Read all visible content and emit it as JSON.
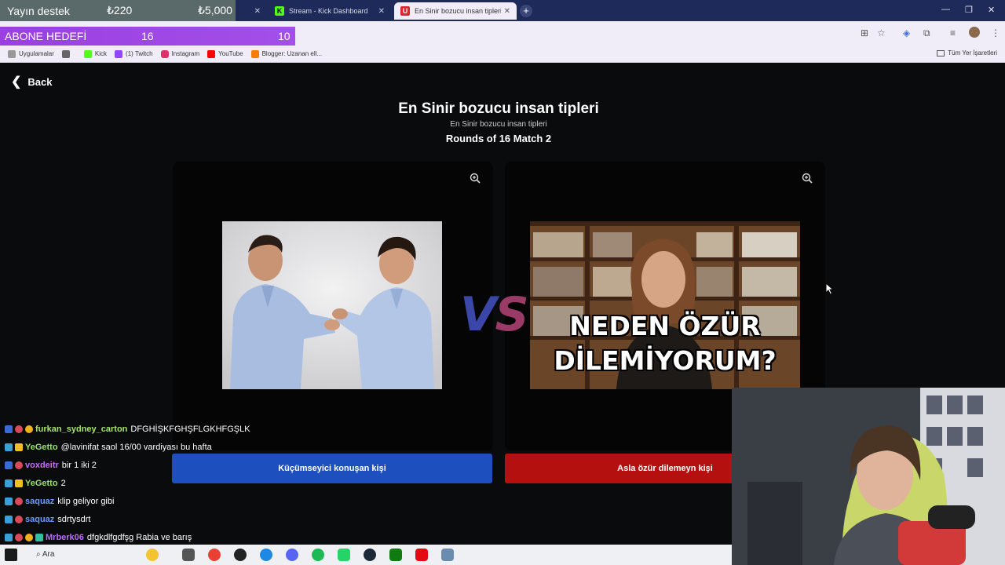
{
  "overlays": {
    "support_label": "Yayın destek",
    "support_current": "₺220",
    "support_goal": "₺5,000",
    "sub_goal_label": "ABONE HEDEFİ",
    "sub_goal_current": "16",
    "sub_goal_target": "10"
  },
  "browser": {
    "tabs": [
      {
        "title": "Stream - Kick Dashboard",
        "active": false
      },
      {
        "title": "En Sinir bozucu insan tipleri | U...",
        "active": true
      }
    ],
    "bookmarks": [
      "Uygulamalar",
      "Kick",
      "(1) Twitch",
      "Instagram",
      "YouTube",
      "Blogger: Uzanan ell..."
    ],
    "bookmarks_right": "Tüm Yer İşaretleri",
    "colors": {
      "tabbar": "#1e2a5a",
      "chrome": "#f1edf8"
    }
  },
  "page": {
    "back_label": "Back",
    "title": "En Sinir bozucu insan tipleri",
    "subtitle": "En Sinir bozucu insan tipleri",
    "round": "Rounds of 16 Match 2",
    "vs_label": "VS",
    "left_choice": "Küçümseyici konuşan kişi",
    "right_choice": "Asla özür dilemeyn kişi",
    "right_image_caption_line1": "NEDEN ÖZÜR",
    "right_image_caption_line2": "DİLEMİYORUM?",
    "colors": {
      "left_button": "#1e4fbf",
      "right_button": "#b51010"
    }
  },
  "chat": [
    {
      "user": "furkan_sydney_carton",
      "text": "DFGHİŞKFGHŞFLGKHFGŞLK",
      "color": "#a6e36b"
    },
    {
      "user": "YeGetto",
      "text": "@lavinifat saol 16/00 vardiyası bu hafta",
      "color": "#9ae06a"
    },
    {
      "user": "voxdeitr",
      "text": "bir 1 iki 2",
      "color": "#c76bff"
    },
    {
      "user": "YeGetto",
      "text": "2",
      "color": "#9ae06a"
    },
    {
      "user": "saquaz",
      "text": "klip geliyor gibi",
      "color": "#6b9bff"
    },
    {
      "user": "saquaz",
      "text": "sdrtysdrt",
      "color": "#6b9bff"
    },
    {
      "user": "Mrberk06",
      "text": "dfgkdlfgdfşg Rabia ve barış",
      "color": "#b86bff"
    }
  ],
  "taskbar": {
    "search_label": "Ara"
  }
}
